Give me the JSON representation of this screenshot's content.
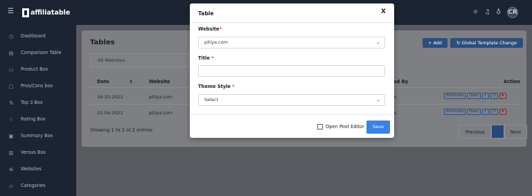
{
  "app": {
    "logo_text": "affiliatable",
    "avatar_initials": "CR"
  },
  "topbar_icons": [
    "menu-icon",
    "sun-icon",
    "bell-icon",
    "lightbulb-icon"
  ],
  "sidebar": {
    "items": [
      {
        "label": "Dashboard",
        "icon": "gauge-icon"
      },
      {
        "label": "Comparison Table",
        "icon": "table-icon"
      },
      {
        "label": "Product Box",
        "icon": "box-icon"
      },
      {
        "label": "Pros/Cons box",
        "icon": "pros-cons-icon"
      },
      {
        "label": "Top 3 Box",
        "icon": "top3-icon"
      },
      {
        "label": "Rating Box",
        "icon": "star-icon"
      },
      {
        "label": "Summary Box",
        "icon": "summary-icon"
      },
      {
        "label": "Versus Box",
        "icon": "versus-icon"
      },
      {
        "label": "Websites",
        "icon": "globe-icon"
      },
      {
        "label": "Categories",
        "icon": "folder-icon"
      }
    ]
  },
  "page": {
    "title": "Tables",
    "add_label": "+ Add",
    "global_label": "Global Template Change",
    "filter_value": "All Websites",
    "columns": {
      "date": "Date",
      "website": "Website",
      "created_by": "ed By",
      "action": "Action"
    },
    "rows": [
      {
        "date": "16-10-2022",
        "website": "pitiya.com",
        "created_by": "e"
      },
      {
        "date": "22-04-2022",
        "website": "pitiya.com",
        "created_by": "e"
      }
    ],
    "action_labels": {
      "shortcode": "Shortcode",
      "open": "Open"
    },
    "showing": "Showing 1 to 2 of 2 entries",
    "pager": {
      "previous": "Previous",
      "current": "1",
      "next": "Next"
    }
  },
  "modal": {
    "title": "Table",
    "close": "X",
    "website_label": "Website",
    "website_value": "pitiya.com",
    "title_label": "Title",
    "title_value": "",
    "theme_label": "Theme Style",
    "theme_value": "Select",
    "required_mark": "*",
    "open_editor_label": "Open Post Editor",
    "save_label": "Save"
  },
  "colors": {
    "accent": "#3a82e8",
    "topbar": "#1c2433",
    "required": "#d43c3c"
  }
}
